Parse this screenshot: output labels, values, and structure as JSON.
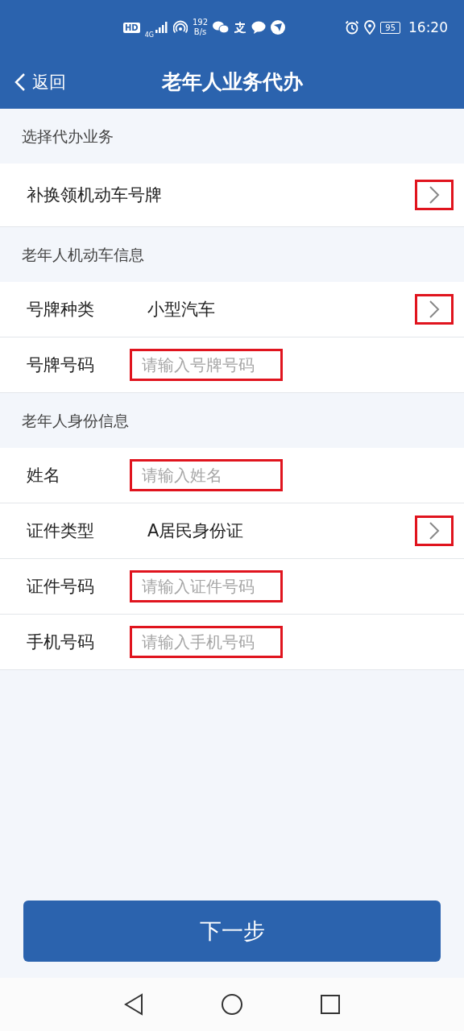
{
  "status_bar": {
    "hd": "HD",
    "network": "4G",
    "speed_value": "192",
    "speed_unit": "B/s",
    "battery": "95",
    "time": "16:20"
  },
  "header": {
    "back": "返回",
    "title": "老年人业务代办"
  },
  "sections": [
    {
      "title": "选择代办业务",
      "rows": [
        {
          "kind": "select",
          "label": "补换领机动车号牌",
          "highlighted": true
        }
      ]
    },
    {
      "title": "老年人机动车信息",
      "rows": [
        {
          "kind": "select",
          "label": "号牌种类",
          "value": "小型汽车",
          "highlighted": true
        },
        {
          "kind": "input",
          "label": "号牌号码",
          "placeholder": "请输入号牌号码",
          "highlighted": true
        }
      ]
    },
    {
      "title": "老年人身份信息",
      "rows": [
        {
          "kind": "input",
          "label": "姓名",
          "placeholder": "请输入姓名",
          "highlighted": true
        },
        {
          "kind": "select",
          "label": "证件类型",
          "value": "A居民身份证",
          "highlighted": true
        },
        {
          "kind": "input",
          "label": "证件号码",
          "placeholder": "请输入证件号码",
          "highlighted": true
        },
        {
          "kind": "input",
          "label": "手机号码",
          "placeholder": "请输入手机号码",
          "highlighted": true
        }
      ]
    }
  ],
  "next_button": "下一步"
}
